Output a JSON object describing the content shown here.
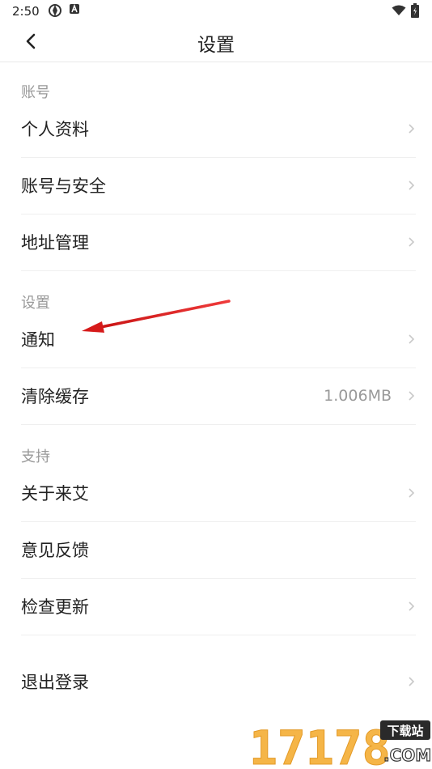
{
  "status": {
    "time": "2:50"
  },
  "header": {
    "title": "设置"
  },
  "sections": [
    {
      "label": "账号",
      "items": [
        {
          "label": "个人资料"
        },
        {
          "label": "账号与安全"
        },
        {
          "label": "地址管理"
        }
      ]
    },
    {
      "label": "设置",
      "items": [
        {
          "label": "通知"
        },
        {
          "label": "清除缓存",
          "value": "1.006MB"
        }
      ]
    },
    {
      "label": "支持",
      "items": [
        {
          "label": "关于来艾"
        },
        {
          "label": "意见反馈"
        },
        {
          "label": "检查更新"
        }
      ]
    }
  ],
  "logout": {
    "label": "退出登录"
  },
  "watermark": {
    "number": "17178",
    "badge": "下载站",
    "suffix": ".COM"
  },
  "colors": {
    "annotation_arrow": "#e01e1e",
    "watermark_orange": "#f5b547",
    "watermark_badge": "#2a2a2a"
  }
}
